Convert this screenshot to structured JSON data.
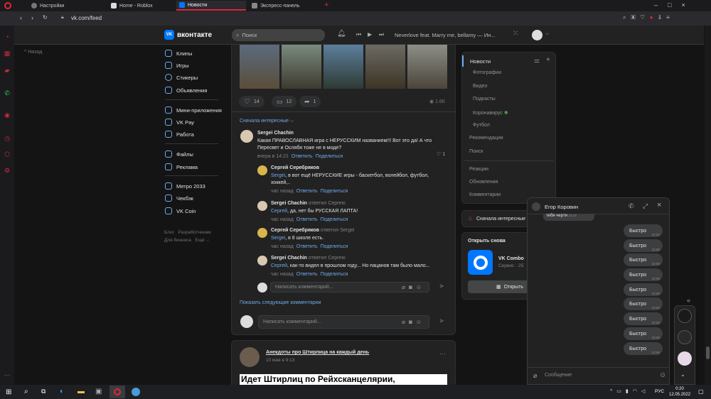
{
  "browser": {
    "tabs": [
      {
        "label": "Настройки"
      },
      {
        "label": "Home - Roblox"
      },
      {
        "label": "Новости"
      },
      {
        "label": "Экспресс-панель"
      }
    ],
    "url": "vk.com/feed",
    "sidebar_back": "Назад"
  },
  "header": {
    "logo_text": "вконтакте",
    "search_placeholder": "Поиск",
    "now_playing": "Neverlove feat. Marry me, bellamy — Ин..."
  },
  "left_menu": {
    "group1": [
      "Клипы",
      "Игры",
      "Стикеры",
      "Объявления"
    ],
    "group2": [
      "Мини-приложения",
      "VK Pay",
      "Работа"
    ],
    "group3": [
      "Файлы",
      "Реклама"
    ],
    "group4": [
      "Метро 2033",
      "Чекбэк",
      "VK Coin"
    ],
    "footer": [
      "Блог",
      "Разработчикам",
      "Для бизнеса",
      "Ещё ⌵"
    ]
  },
  "post1": {
    "likes": "14",
    "comments": "12",
    "shares": "1",
    "views": "1.6K",
    "sort_label": "Сначала интересные ⌵",
    "comments_list": [
      {
        "author": "Sergei Chachin",
        "text": "Какая ПРАВОСЛАВНАЯ игра с НЕРУССКИМ названием!!! Вот это да! А что Пересвет и Ослябя тоже не в моде?",
        "time": "вчера в 14:21",
        "reply": "Ответить",
        "share": "Поделиться",
        "likes": "1"
      },
      {
        "author": "Сергей Серебряков",
        "mention": "Sergei",
        "text": ", в вот ещё НЕРУССКИЕ игры - баскетбол, волейбол, футбол, хоккей,..",
        "time": "час назад",
        "reply": "Ответить",
        "share": "Поделиться"
      },
      {
        "author": "Sergei Chachin",
        "answered": "ответил Сергею",
        "mention": "Сергей",
        "text": ", да, нет бы РУССКАЯ ЛАПТА!",
        "time": "час назад",
        "reply": "Ответить",
        "share": "Поделиться"
      },
      {
        "author": "Сергей Серебряков",
        "answered": "ответил Sergei",
        "mention": "Sergei",
        "text": ", в 8 школе есть.",
        "time": "час назад",
        "reply": "Ответить",
        "share": "Поделиться"
      },
      {
        "author": "Sergei Chachin",
        "answered": "ответил Сергею",
        "mention": "Сергей",
        "text": ", как-то видел в прошлом году... Но пацанов там было мало...",
        "time": "час назад",
        "reply": "Ответить",
        "share": "Поделиться"
      }
    ],
    "reply_placeholder": "Написать комментарий...",
    "show_more": "Показать следующие комментарии",
    "comment_placeholder": "Написать комментарий..."
  },
  "post2": {
    "group": "Анекдоты про Штирлица на каждый день",
    "time": "10 мая в 9:13",
    "text": "Идет Штирлиц по Рейхсканцелярии,"
  },
  "right_nav": {
    "title": "Новости",
    "items": [
      "Фотографии",
      "Видео",
      "Подкасты",
      "Коронавирус",
      "Футбол"
    ],
    "items2": [
      "Рекомендации",
      "Поиск"
    ],
    "items3": [
      "Реакции",
      "Обновления",
      "Комментарии"
    ],
    "sort": "Сначала интересные",
    "open_again": "Открыть снова",
    "app_name": "VK Combo",
    "app_sub": "Сервис · 25",
    "open_button": "Открыть"
  },
  "chat": {
    "name": "Егор Коровин",
    "prev_text": "тебя черти",
    "prev_time": "22:22",
    "messages": [
      {
        "text": "Быстро",
        "time": "22:54"
      },
      {
        "text": "Быстро",
        "time": "22:55"
      },
      {
        "text": "Быстро",
        "time": "22:55"
      },
      {
        "text": "Быстро",
        "time": "22:55"
      },
      {
        "text": "Быстро",
        "time": "22:55"
      },
      {
        "text": "Быстро",
        "time": "22:55"
      },
      {
        "text": "Быстро",
        "time": "22:55"
      },
      {
        "text": "Быстро",
        "time": "22:55"
      },
      {
        "text": "Быстро",
        "time": "22:55"
      }
    ],
    "input_placeholder": "Сообщение"
  },
  "taskbar": {
    "time": "0:20",
    "date": "12.05.2022",
    "lang": "РУС"
  },
  "colors": {
    "accent": "#71aaeb",
    "brand": "#0077ff",
    "opera": "#e0263a"
  }
}
